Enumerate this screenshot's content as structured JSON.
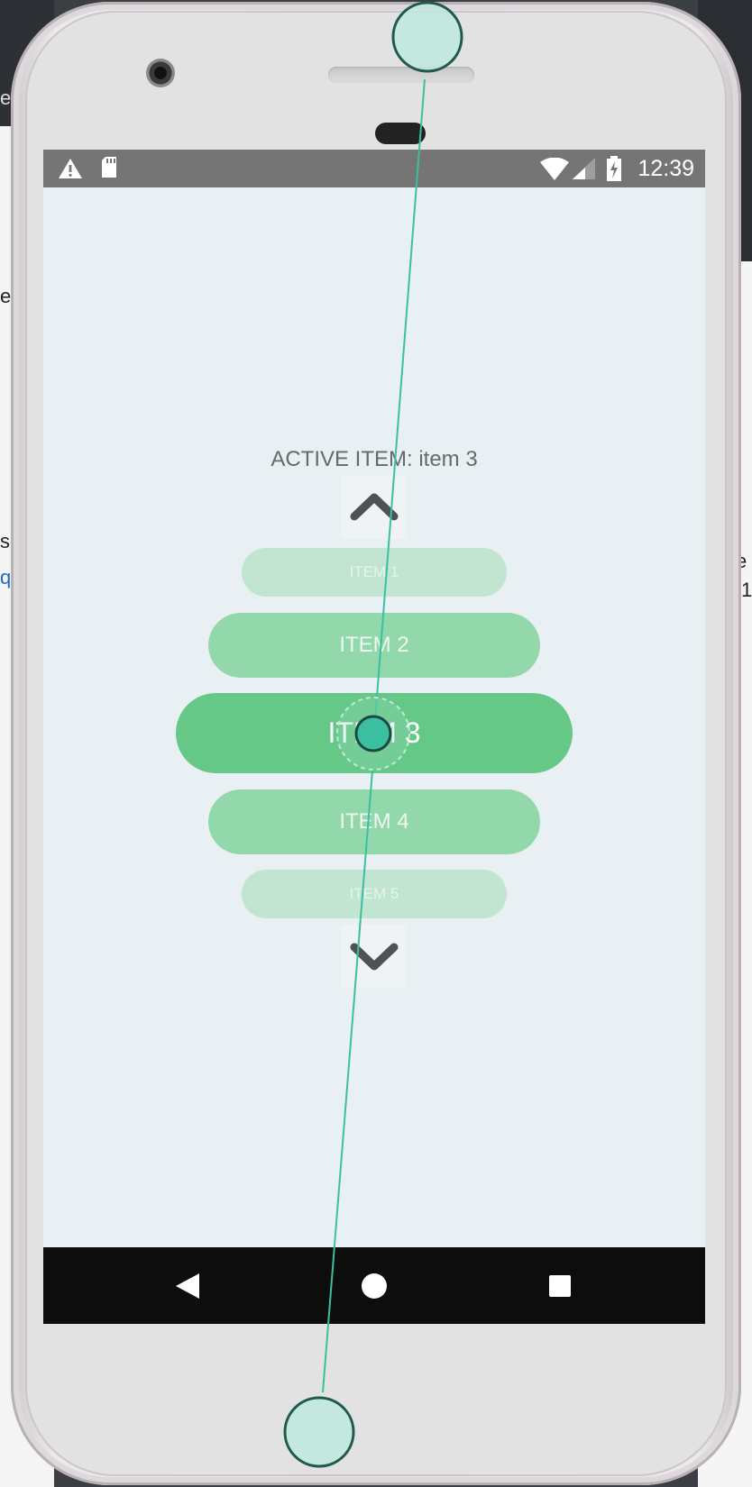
{
  "statusbar": {
    "time": "12:39",
    "icons": [
      "warning-icon",
      "sd-card-icon",
      "wifi-icon",
      "signal-icon",
      "battery-charging-icon"
    ]
  },
  "app": {
    "active_label": "ACTIVE ITEM: item 3",
    "up_icon": "chevron-up-icon",
    "down_icon": "chevron-down-icon",
    "items": [
      {
        "label": "ITEM 1",
        "state": "far"
      },
      {
        "label": "ITEM 2",
        "state": "near"
      },
      {
        "label": "ITEM 3",
        "state": "active"
      },
      {
        "label": "ITEM 4",
        "state": "near"
      },
      {
        "label": "ITEM 5",
        "state": "far"
      }
    ]
  },
  "navbar": {
    "icons": [
      "back-icon",
      "home-icon",
      "recents-icon"
    ]
  },
  "colors": {
    "active_item": "#66c887",
    "near_item": "#93d8aa",
    "far_item": "#c1e5d1",
    "screen_bg": "#e9f0f3",
    "statusbar": "#757575",
    "touch_accent": "#3bbfa0"
  },
  "background": {
    "left_fragments": [
      "er",
      "e",
      "s",
      "q"
    ],
    "right_fragments": [
      "e",
      "1"
    ]
  }
}
